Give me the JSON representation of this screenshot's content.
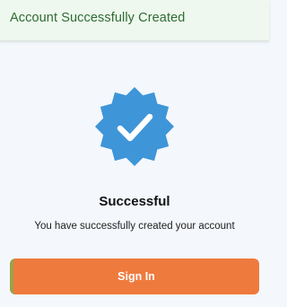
{
  "header": {
    "title": "Account Successfully Created"
  },
  "badge": {
    "icon": "verified-check-icon",
    "color": "#3e95d8",
    "check_color": "#ffffff"
  },
  "content": {
    "title": "Successful",
    "message": "You have successfully created your account"
  },
  "actions": {
    "sign_in_label": "Sign In",
    "button_color": "#ef7a3e"
  }
}
